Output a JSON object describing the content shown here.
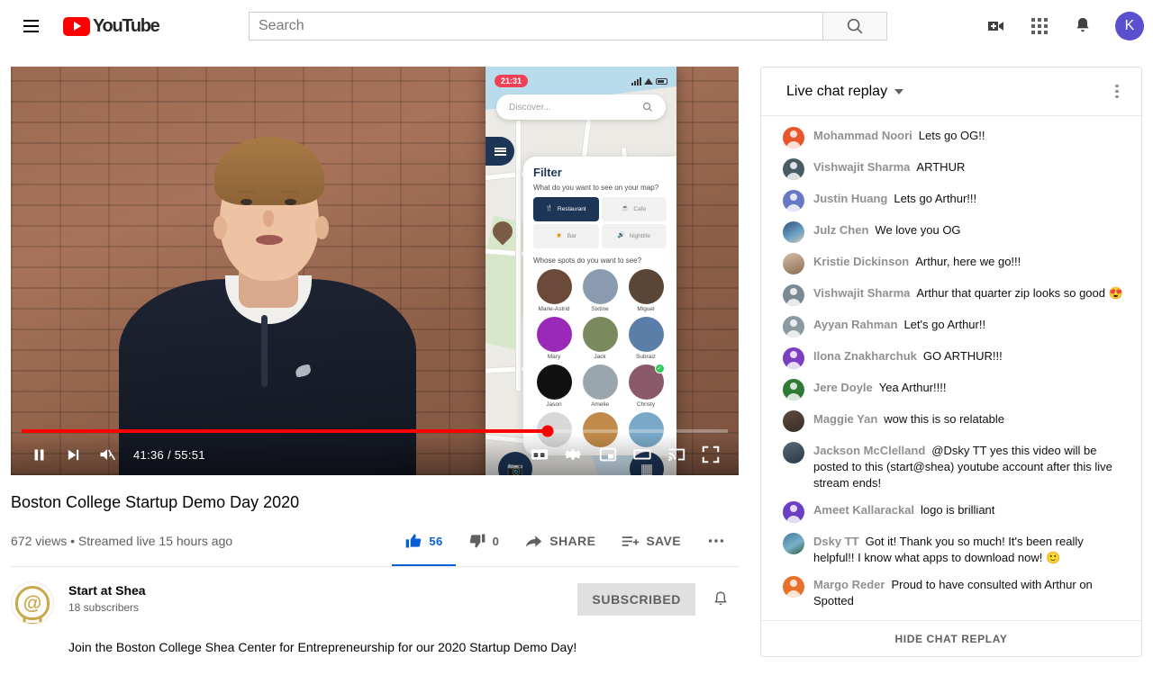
{
  "masthead": {
    "menu_icon": "hamburger-icon",
    "logo_text": "YouTube",
    "search_placeholder": "Search",
    "search_value": "",
    "search_icon": "search-icon",
    "create_icon": "video-camera-plus-icon",
    "apps_icon": "apps-grid-icon",
    "notifications_icon": "bell-icon",
    "avatar_letter": "K",
    "avatar_color": "#5a4fcf"
  },
  "player": {
    "current_time": "41:36",
    "duration": "55:51",
    "time_display": "41:36 / 55:51",
    "progress_percent": 74.5,
    "progress_color": "#ff0000",
    "play_state": "playing",
    "muted": true,
    "controls": {
      "pause": "pause-icon",
      "next": "next-video-icon",
      "volume": "volume-muted-icon",
      "captions": "closed-captions-icon",
      "settings": "settings-gear-icon",
      "miniplayer": "miniplayer-icon",
      "theater": "theater-mode-icon",
      "cast": "cast-icon",
      "fullscreen": "fullscreen-icon"
    },
    "phone_mockup": {
      "status_time": "21:31",
      "search_placeholder": "Discover...",
      "filter_title": "Filter",
      "filter_question_1": "What do you want to see on your map?",
      "filter_question_2": "Whose spots do you want to see?",
      "categories": [
        {
          "label": "Restaurant",
          "icon": "cutlery-icon",
          "selected": true
        },
        {
          "label": "Cafe",
          "icon": "coffee-cup-icon",
          "selected": false
        },
        {
          "label": "Bar",
          "icon": "beer-mug-icon",
          "selected": false
        },
        {
          "label": "Nightlife",
          "icon": "speaker-icon",
          "selected": false
        }
      ],
      "people": [
        {
          "name": "Marie-Astrid",
          "color": "#6b4a3a",
          "checked": false
        },
        {
          "name": "Sixtine",
          "color": "#8a9bb0",
          "checked": false
        },
        {
          "name": "Miguel",
          "color": "#5a4636",
          "checked": false
        },
        {
          "name": "Mary",
          "color": "#9b29b8",
          "checked": false
        },
        {
          "name": "Jack",
          "color": "#7b8a5e",
          "checked": false
        },
        {
          "name": "Subraiz",
          "color": "#5b7ea8",
          "checked": false
        },
        {
          "name": "Jason",
          "color": "#111111",
          "checked": false
        },
        {
          "name": "Amelie",
          "color": "#9aa6ae",
          "checked": false
        },
        {
          "name": "Christy",
          "color": "#8a5a6a",
          "checked": true
        }
      ]
    }
  },
  "video": {
    "title": "Boston College Startup Demo Day 2020",
    "views": "672 views",
    "separator": "•",
    "published": "Streamed live 15 hours ago",
    "meta_line": "672 views • Streamed live 15 hours ago",
    "description": "Join the Boston College Shea Center for Entrepreneurship for our 2020 Startup Demo Day!"
  },
  "actions": {
    "like": {
      "label": "",
      "count": "56",
      "icon": "thumbs-up-icon",
      "active": true
    },
    "dislike": {
      "label": "",
      "count": "0",
      "icon": "thumbs-down-icon",
      "active": false
    },
    "share": {
      "label": "SHARE",
      "icon": "share-arrow-icon"
    },
    "save": {
      "label": "SAVE",
      "icon": "save-playlist-icon"
    },
    "more": {
      "label": "",
      "icon": "more-horizontal-icon"
    },
    "accent_color": "#065fd4"
  },
  "channel": {
    "name": "Start at Shea",
    "subscribers": "18 subscribers",
    "avatar_icon": "at-lightbulb-logo",
    "avatar_color": "#c8a84b",
    "subscribe_label": "SUBSCRIBED",
    "notification_icon": "bell-outline-icon"
  },
  "chat": {
    "title": "Live chat replay",
    "dropdown_icon": "chevron-down-icon",
    "menu_icon": "more-vertical-icon",
    "hide_label": "HIDE CHAT REPLAY",
    "messages": [
      {
        "author": "Mohammad Noori",
        "text": "Lets go OG!!",
        "avatar_color": "#e8562a"
      },
      {
        "author": "Vishwajit Sharma",
        "text": "ARTHUR",
        "avatar_color": "#4a5c63"
      },
      {
        "author": "Justin Huang",
        "text": "Lets go Arthur!!!",
        "avatar_color": "#6878c4"
      },
      {
        "author": "Julz Chen",
        "text": "We love you OG",
        "avatar_color": "#3f6f9f"
      },
      {
        "author": "Kristie Dickinson",
        "text": "Arthur, here we go!!!",
        "avatar_color": "#a98a76"
      },
      {
        "author": "Vishwajit Sharma",
        "text": "Arthur that quarter zip looks so good 😍",
        "avatar_color": "#7a8a90"
      },
      {
        "author": "Ayyan Rahman",
        "text": "Let's go Arthur!!",
        "avatar_color": "#8a9aa0"
      },
      {
        "author": "Ilona Znakharchuk",
        "text": "GO ARTHUR!!!",
        "avatar_color": "#7b3fbf"
      },
      {
        "author": "Jere Doyle",
        "text": "Yea Arthur!!!!",
        "avatar_color": "#2f7a34"
      },
      {
        "author": "Maggie Yan",
        "text": "wow this is so relatable",
        "avatar_color": "#5d4a3f"
      },
      {
        "author": "Jackson McClelland",
        "text": "@Dsky TT yes this video will be posted to this (start@shea) youtube account after this live stream ends!",
        "avatar_color": "#3a4a55"
      },
      {
        "author": "Ameet Kallarackal",
        "text": "logo is brilliant",
        "avatar_color": "#6b3fc4"
      },
      {
        "author": "Dsky TT",
        "text": "Got it! Thank you so much! It's been really helpful!! I know what apps to download now! 🙂",
        "avatar_color": "#3f7a9f"
      },
      {
        "author": "Margo Reder",
        "text": "Proud to have consulted with Arthur on Spotted",
        "avatar_color": "#e8702a"
      }
    ]
  }
}
